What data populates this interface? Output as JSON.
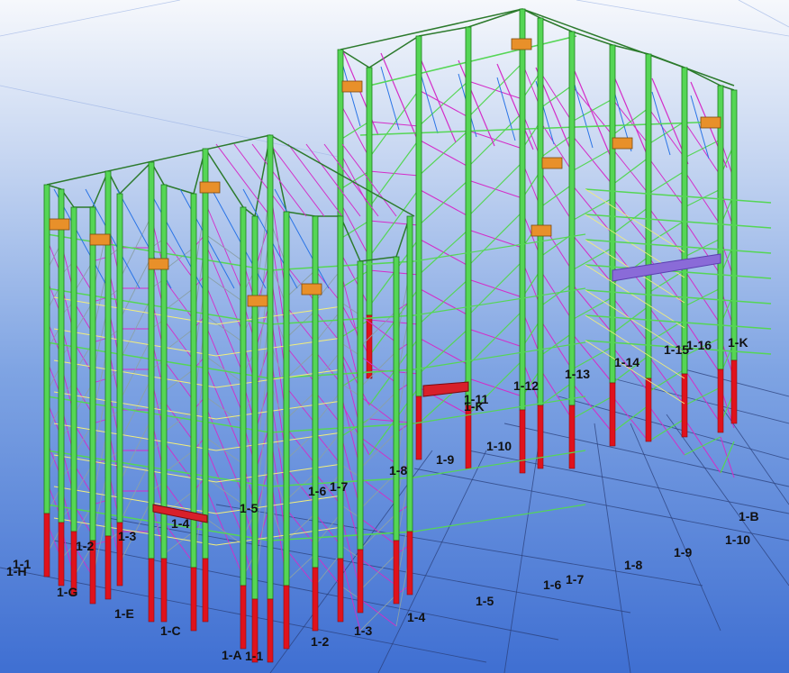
{
  "view": {
    "colors": {
      "column": "#55d655",
      "column_edge": "#1b7d1b",
      "base": "#e0121c",
      "brace_magenta": "#d42cc8",
      "brace_yellow": "#f2ee7a",
      "truss_blue": "#2a74e6",
      "joint_orange": "#e8902a",
      "platform_red": "#d8202a",
      "grid_line": "#2a3f7a"
    }
  },
  "grid_labels": [
    {
      "id": "1-1-front",
      "text": "1-1"
    },
    {
      "id": "1-2-front",
      "text": "1-2"
    },
    {
      "id": "1-3-front",
      "text": "1-3"
    },
    {
      "id": "1-4-front",
      "text": "1-4"
    },
    {
      "id": "1-5-front",
      "text": "1-5"
    },
    {
      "id": "1-6-front",
      "text": "1-6"
    },
    {
      "id": "1-7-front",
      "text": "1-7"
    },
    {
      "id": "1-8-front",
      "text": "1-8"
    },
    {
      "id": "1-9-front",
      "text": "1-9"
    },
    {
      "id": "1-10-front",
      "text": "1-10"
    },
    {
      "id": "1-B",
      "text": "1-B"
    },
    {
      "id": "1-A",
      "text": "1-A"
    },
    {
      "id": "1-C",
      "text": "1-C"
    },
    {
      "id": "1-E",
      "text": "1-E"
    },
    {
      "id": "1-G",
      "text": "1-G"
    },
    {
      "id": "1-H",
      "text": "1-H"
    },
    {
      "id": "1-1-left",
      "text": "1-1"
    },
    {
      "id": "1-2-left",
      "text": "1-2"
    },
    {
      "id": "1-3-left",
      "text": "1-3"
    },
    {
      "id": "1-4-left",
      "text": "1-4"
    },
    {
      "id": "1-5-mid",
      "text": "1-5"
    },
    {
      "id": "1-6-mid",
      "text": "1-6"
    },
    {
      "id": "1-7-mid",
      "text": "1-7"
    },
    {
      "id": "1-8-mid",
      "text": "1-8"
    },
    {
      "id": "1-9-mid",
      "text": "1-9"
    },
    {
      "id": "1-10-mid",
      "text": "1-10"
    },
    {
      "id": "1-11-mid",
      "text": "1-11"
    },
    {
      "id": "1-K-mid",
      "text": "1-K"
    },
    {
      "id": "1-12-back",
      "text": "1-12"
    },
    {
      "id": "1-13-back",
      "text": "1-13"
    },
    {
      "id": "1-14-back",
      "text": "1-14"
    },
    {
      "id": "1-15-back",
      "text": "1-15"
    },
    {
      "id": "1-16-back",
      "text": "1-16"
    },
    {
      "id": "1-K-back",
      "text": "1-K"
    }
  ]
}
